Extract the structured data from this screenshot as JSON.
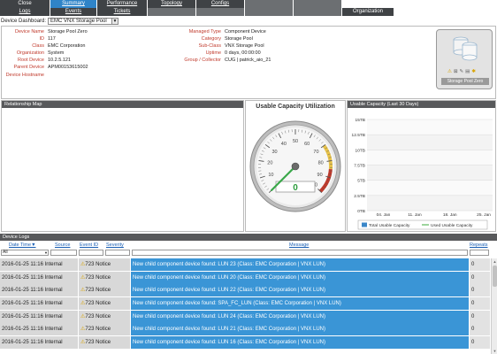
{
  "nav": {
    "row1": [
      {
        "label": "Close",
        "state": "normal",
        "w": 0
      },
      {
        "label": "Summary",
        "state": "active"
      },
      {
        "label": "Performance",
        "state": "normal"
      },
      {
        "label": "Topology",
        "state": "normal"
      },
      {
        "label": "Configs",
        "state": "normal"
      },
      {
        "label": "",
        "state": "dim"
      },
      {
        "label": "",
        "state": "dim"
      }
    ],
    "row2": [
      {
        "label": "Logs",
        "state": "normal"
      },
      {
        "label": "Events",
        "state": "normal"
      },
      {
        "label": "Tickets",
        "state": "normal"
      },
      {
        "label": "",
        "state": "dim"
      },
      {
        "label": "",
        "state": "dim"
      },
      {
        "label": "",
        "state": "dim"
      },
      {
        "label": "",
        "state": "dim"
      },
      {
        "label": "Organization",
        "state": "normal"
      }
    ]
  },
  "dashboard": {
    "label": "Device Dashboard",
    "selected": "EMC VNX Storage Pool"
  },
  "device": {
    "left": [
      {
        "label": "Device Name",
        "value": "Storage Pool Zero"
      },
      {
        "label": "ID",
        "value": "117"
      },
      {
        "label": "Class",
        "value": "EMC Corporation"
      },
      {
        "label": "Organization",
        "value": "System"
      },
      {
        "label": "Root Device",
        "value": "10.2.5.121"
      },
      {
        "label": "Parent Device",
        "value": "APM00153615002"
      },
      {
        "label": "Device Hostname",
        "value": ""
      }
    ],
    "right": [
      {
        "label": "Managed Type",
        "value": "Component Device"
      },
      {
        "label": "Category",
        "value": "Storage Pool"
      },
      {
        "label": "Sub-Class",
        "value": "VNX Storage Pool"
      },
      {
        "label": "Uptime",
        "value": "0 days, 00:00:00"
      },
      {
        "label": "Group / Collector",
        "value": "CUG | patrick_aio_21"
      }
    ],
    "caption": "Storage Pool Zero",
    "status_icons": [
      "warning-icon",
      "lock-icon",
      "wrench-icon",
      "document-icon",
      "info-icon"
    ]
  },
  "relationship_map": {
    "title": "Relationship Map"
  },
  "gauge": {
    "title": "Usable Capacity Utilization",
    "value": "0",
    "ticks": [
      "0",
      "10",
      "20",
      "30",
      "40",
      "50",
      "60",
      "70",
      "80",
      "90",
      "100"
    ],
    "percent": 0
  },
  "capacity_chart": {
    "panel_title": "Usable Capacity (Last 30 Days)",
    "legend": [
      "Total Usable Capacity",
      "Used Usable Capacity"
    ]
  },
  "chart_data": {
    "type": "area",
    "title": "",
    "x": [
      "04. Jan",
      "11. Jan",
      "18. Jan",
      "25. Jan"
    ],
    "y_ticks": [
      "0TB",
      "2.5TB",
      "5TB",
      "7.5TB",
      "10TB",
      "12.5TB",
      "15TB"
    ],
    "ylim": [
      0,
      15
    ],
    "series": [
      {
        "name": "Total Usable Capacity",
        "values": [],
        "color": "#3a86c8"
      },
      {
        "name": "Used Usable Capacity",
        "values": [],
        "color": "#5cb85c"
      }
    ],
    "legend_placement": "bottom"
  },
  "logs": {
    "title": "Device Logs",
    "columns": {
      "date": "Date Time▼",
      "source": "Source",
      "event_id": "Event ID",
      "severity": "Severity",
      "message": "Message",
      "repeats": "Repeats"
    },
    "filter_all": "All",
    "rows": [
      {
        "date": "2016-01-25 11:16",
        "source": "Internal",
        "event_id": "723",
        "severity": "Notice",
        "message": "New child component device found: LUN 23 (Class: EMC Corporation | VNX LUN)",
        "repeats": "0"
      },
      {
        "date": "2016-01-25 11:16",
        "source": "Internal",
        "event_id": "723",
        "severity": "Notice",
        "message": "New child component device found: LUN 20 (Class: EMC Corporation | VNX LUN)",
        "repeats": "0"
      },
      {
        "date": "2016-01-25 11:16",
        "source": "Internal",
        "event_id": "723",
        "severity": "Notice",
        "message": "New child component device found: LUN 22 (Class: EMC Corporation | VNX LUN)",
        "repeats": "0"
      },
      {
        "date": "2016-01-25 11:16",
        "source": "Internal",
        "event_id": "723",
        "severity": "Notice",
        "message": "New child component device found: SPA_FC_LUN (Class: EMC Corporation | VNX LUN)",
        "repeats": "0"
      },
      {
        "date": "2016-01-25 11:16",
        "source": "Internal",
        "event_id": "723",
        "severity": "Notice",
        "message": "New child component device found: LUN 24 (Class: EMC Corporation | VNX LUN)",
        "repeats": "0"
      },
      {
        "date": "2016-01-25 11:16",
        "source": "Internal",
        "event_id": "723",
        "severity": "Notice",
        "message": "New child component device found: LUN 21 (Class: EMC Corporation | VNX LUN)",
        "repeats": "0"
      },
      {
        "date": "2016-01-25 11:16",
        "source": "Internal",
        "event_id": "723",
        "severity": "Notice",
        "message": "New child component device found: LUN 16 (Class: EMC Corporation | VNX LUN)",
        "repeats": "0"
      }
    ]
  }
}
